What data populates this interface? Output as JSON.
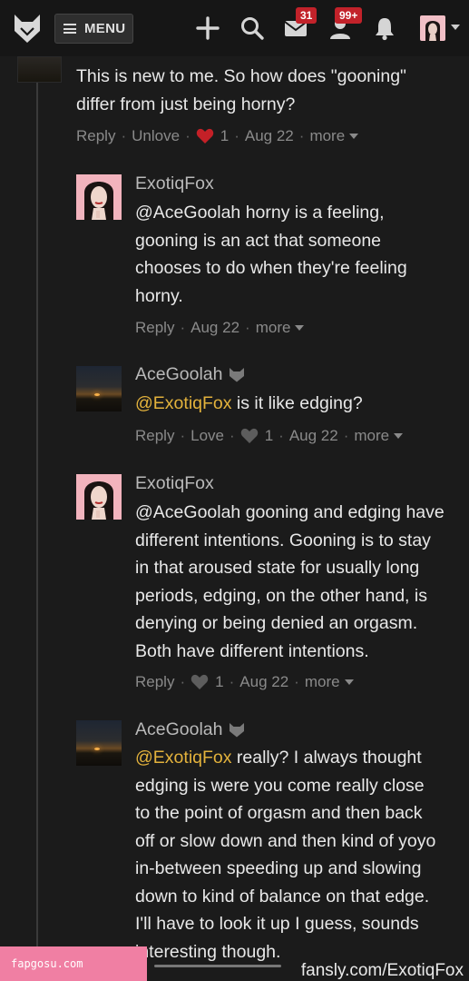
{
  "topbar": {
    "menu_label": "MENU",
    "messages_badge": "31",
    "notifications_badge": "99+",
    "accent_color": "#c2222a"
  },
  "comments": [
    {
      "author": "",
      "text": "This is new to me. So how does \"gooning\"\ndiffer from just being horny?",
      "actions": {
        "reply": "Reply",
        "love": "Unlove",
        "likes": "1",
        "date": "Aug 22",
        "more": "more"
      }
    },
    {
      "author": "ExotiqFox",
      "text": "@AceGoolah horny is a feeling,\ngooning is an act that someone\nchooses to do when they're feeling\nhorny.",
      "actions": {
        "reply": "Reply",
        "date": "Aug 22",
        "more": "more"
      }
    },
    {
      "author": "AceGoolah",
      "mention": "@ExotiqFox",
      "text": " is it like edging?",
      "actions": {
        "reply": "Reply",
        "love": "Love",
        "likes": "1",
        "date": "Aug 22",
        "more": "more"
      }
    },
    {
      "author": "ExotiqFox",
      "text": "@AceGoolah gooning and edging have\ndifferent intentions. Gooning is to stay\nin that aroused state for usually long\nperiods, edging, on the other hand, is\ndenying or being denied an orgasm.\nBoth have different intentions.",
      "actions": {
        "reply": "Reply",
        "likes": "1",
        "date": "Aug 22",
        "more": "more"
      }
    },
    {
      "author": "AceGoolah",
      "mention": "@ExotiqFox",
      "text": " really? I always thought\nedging is were you come really close\nto the point of orgasm and then back\noff or slow down and then kind of yoyo\nin-between speeding up and slowing\ndown to kind of balance on that edge.\nI'll have to look it up I guess, sounds\ninteresting though."
    }
  ],
  "watermarks": {
    "left": "fapgosu.com",
    "right": "fansly.com/ExotiqFox"
  }
}
